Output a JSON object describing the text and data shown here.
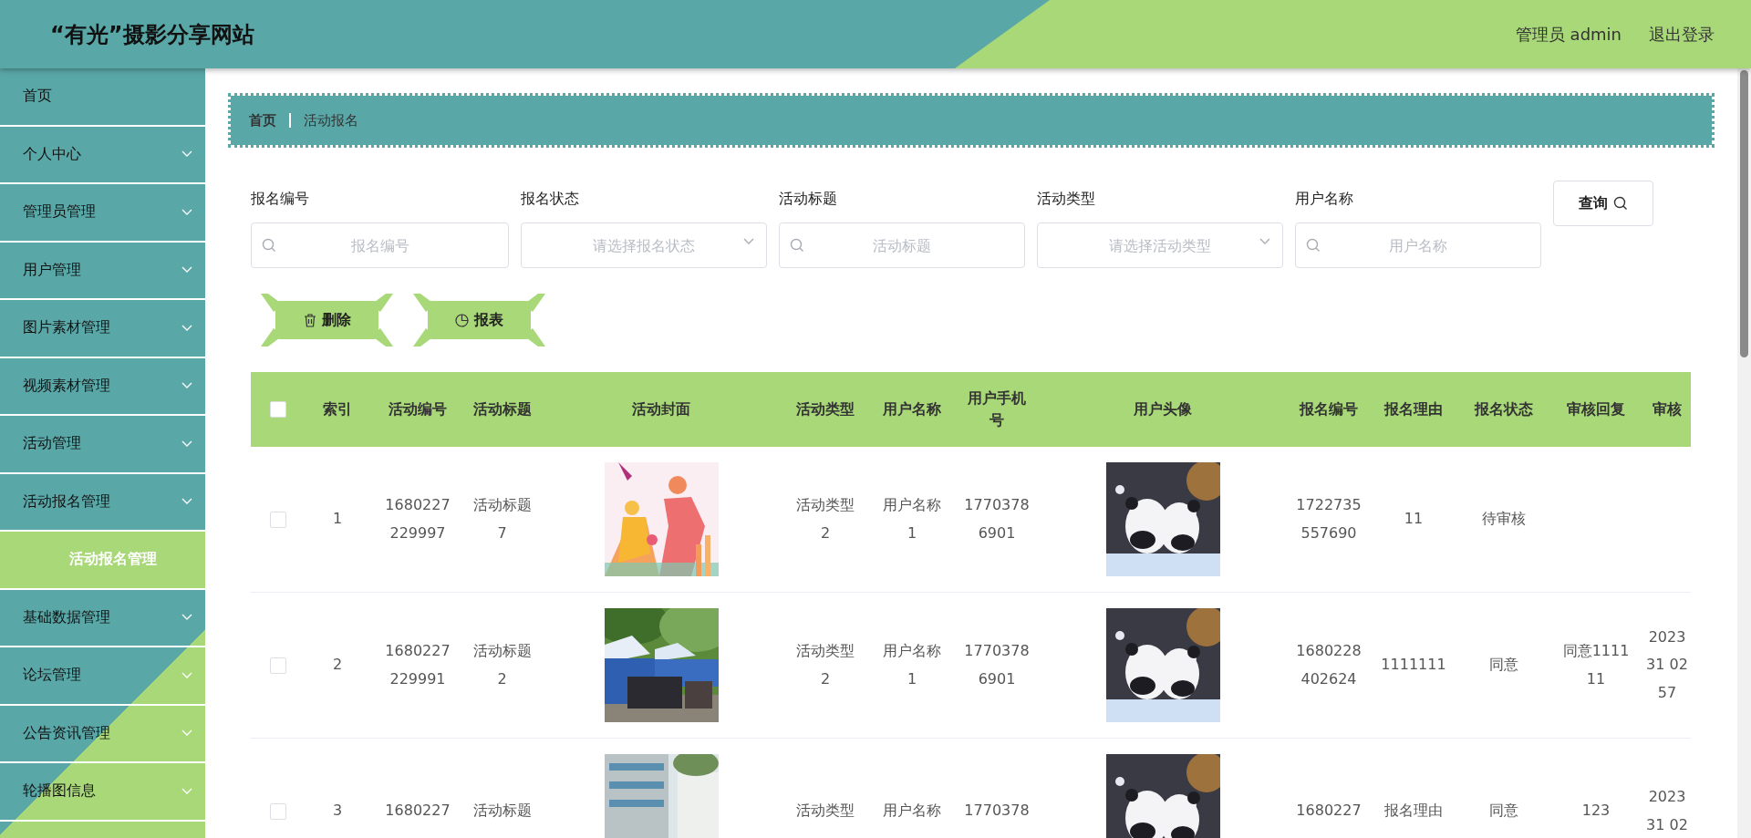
{
  "header": {
    "title": "“有光”摄影分享网站",
    "user": "管理员 admin",
    "logout": "退出登录"
  },
  "sidebar": {
    "items": [
      {
        "label": "首页",
        "kind": "link"
      },
      {
        "label": "个人中心",
        "kind": "menu"
      },
      {
        "label": "管理员管理",
        "kind": "menu"
      },
      {
        "label": "用户管理",
        "kind": "menu"
      },
      {
        "label": "图片素材管理",
        "kind": "menu"
      },
      {
        "label": "视频素材管理",
        "kind": "menu"
      },
      {
        "label": "活动管理",
        "kind": "menu"
      },
      {
        "label": "活动报名管理",
        "kind": "menu",
        "expanded": true,
        "children": [
          {
            "label": "活动报名管理",
            "selected": true
          }
        ]
      },
      {
        "label": "基础数据管理",
        "kind": "menu"
      },
      {
        "label": "论坛管理",
        "kind": "menu"
      },
      {
        "label": "公告资讯管理",
        "kind": "menu"
      },
      {
        "label": "轮播图信息",
        "kind": "menu"
      }
    ]
  },
  "breadcrumb": [
    {
      "label": "首页",
      "kind": "link"
    },
    {
      "label": "活动报名",
      "kind": "current"
    }
  ],
  "filters": [
    {
      "label": "报名编号",
      "kind": "text",
      "placeholder": "报名编号"
    },
    {
      "label": "报名状态",
      "kind": "select",
      "placeholder": "请选择报名状态"
    },
    {
      "label": "活动标题",
      "kind": "text",
      "placeholder": "活动标题"
    },
    {
      "label": "活动类型",
      "kind": "select",
      "placeholder": "请选择活动类型"
    },
    {
      "label": "用户名称",
      "kind": "text",
      "placeholder": "用户名称"
    }
  ],
  "search_button": "查询",
  "actions": [
    {
      "label": "删除"
    },
    {
      "label": "报表"
    }
  ],
  "table": {
    "all_selected": false,
    "columns": [
      {
        "label": "索引",
        "kind": "text"
      },
      {
        "label": "活动编号",
        "kind": "text"
      },
      {
        "label": "活动标题",
        "kind": "text"
      },
      {
        "label": "活动封面",
        "kind": "picture"
      },
      {
        "label": "活动类型",
        "kind": "text"
      },
      {
        "label": "用户名称",
        "kind": "text"
      },
      {
        "label": "用户手机号",
        "kind": "text"
      },
      {
        "label": "用户头像",
        "kind": "picture"
      },
      {
        "label": "报名编号",
        "kind": "text"
      },
      {
        "label": "报名理由",
        "kind": "text"
      },
      {
        "label": "报名状态",
        "kind": "text"
      },
      {
        "label": "审核回复",
        "kind": "text"
      },
      {
        "label": "审核",
        "kind": "text"
      }
    ],
    "rows": [
      {
        "selected": false,
        "cells": [
          "1",
          "1680227\n229997",
          "活动标题\n7",
          {
            "kind": "picture"
          },
          "活动类型\n2",
          "用户名称\n1",
          "1770378\n6901",
          {
            "kind": "picture"
          },
          "1722735\n557690",
          "11",
          "待审核",
          "",
          ""
        ]
      },
      {
        "selected": false,
        "cells": [
          "2",
          "1680227\n229991",
          "活动标题\n2",
          {
            "kind": "picture"
          },
          "活动类型\n2",
          "用户名称\n1",
          "1770378\n6901",
          {
            "kind": "picture"
          },
          "1680228\n402624",
          "1111111",
          "同意",
          "同意1111\n11",
          "2023\n31 02\n57"
        ]
      },
      {
        "selected": false,
        "cells": [
          "3",
          "1680227",
          "活动标题",
          {
            "kind": "picture"
          },
          "活动类型",
          "用户名称",
          "1770378",
          {
            "kind": "picture"
          },
          "1680227",
          "报名理由",
          "同意",
          "123",
          "2023\n31 02"
        ]
      }
    ]
  }
}
